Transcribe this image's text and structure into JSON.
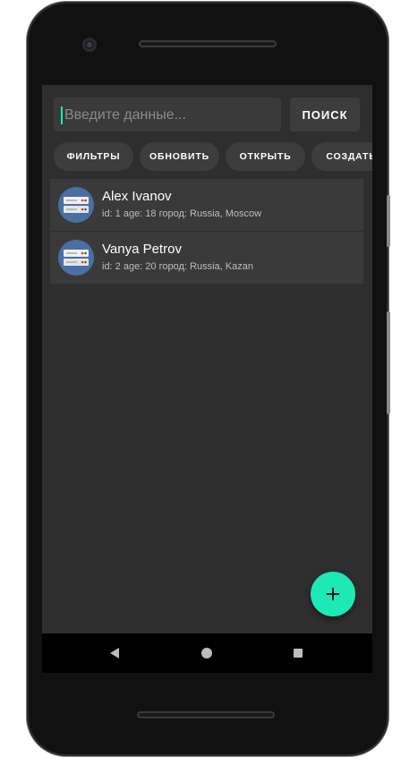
{
  "search": {
    "placeholder": "Введите данные...",
    "value": "",
    "button_label": "ПОИСК"
  },
  "chips": [
    {
      "label": "ФИЛЬТРЫ"
    },
    {
      "label": "ОБНОВИТЬ"
    },
    {
      "label": "ОТКРЫТЬ"
    },
    {
      "label": "СОЗДАТЬ"
    }
  ],
  "list": {
    "items": [
      {
        "title": "Alex Ivanov",
        "subtitle": "id: 1 age: 18 город: Russia, Moscow",
        "icon": "server-icon"
      },
      {
        "title": "Vanya Petrov",
        "subtitle": "id: 2 age: 20 город: Russia, Kazan",
        "icon": "server-icon"
      }
    ]
  },
  "fab": {
    "icon": "plus-icon",
    "symbol": "+"
  },
  "colors": {
    "accent": "#1de9b6",
    "screen_background": "#2e2e2e",
    "surface": "#3a3a3a",
    "avatar_background": "#4a6fa5"
  },
  "navbar": {
    "icons": [
      "back-icon",
      "home-icon",
      "recents-icon"
    ]
  }
}
